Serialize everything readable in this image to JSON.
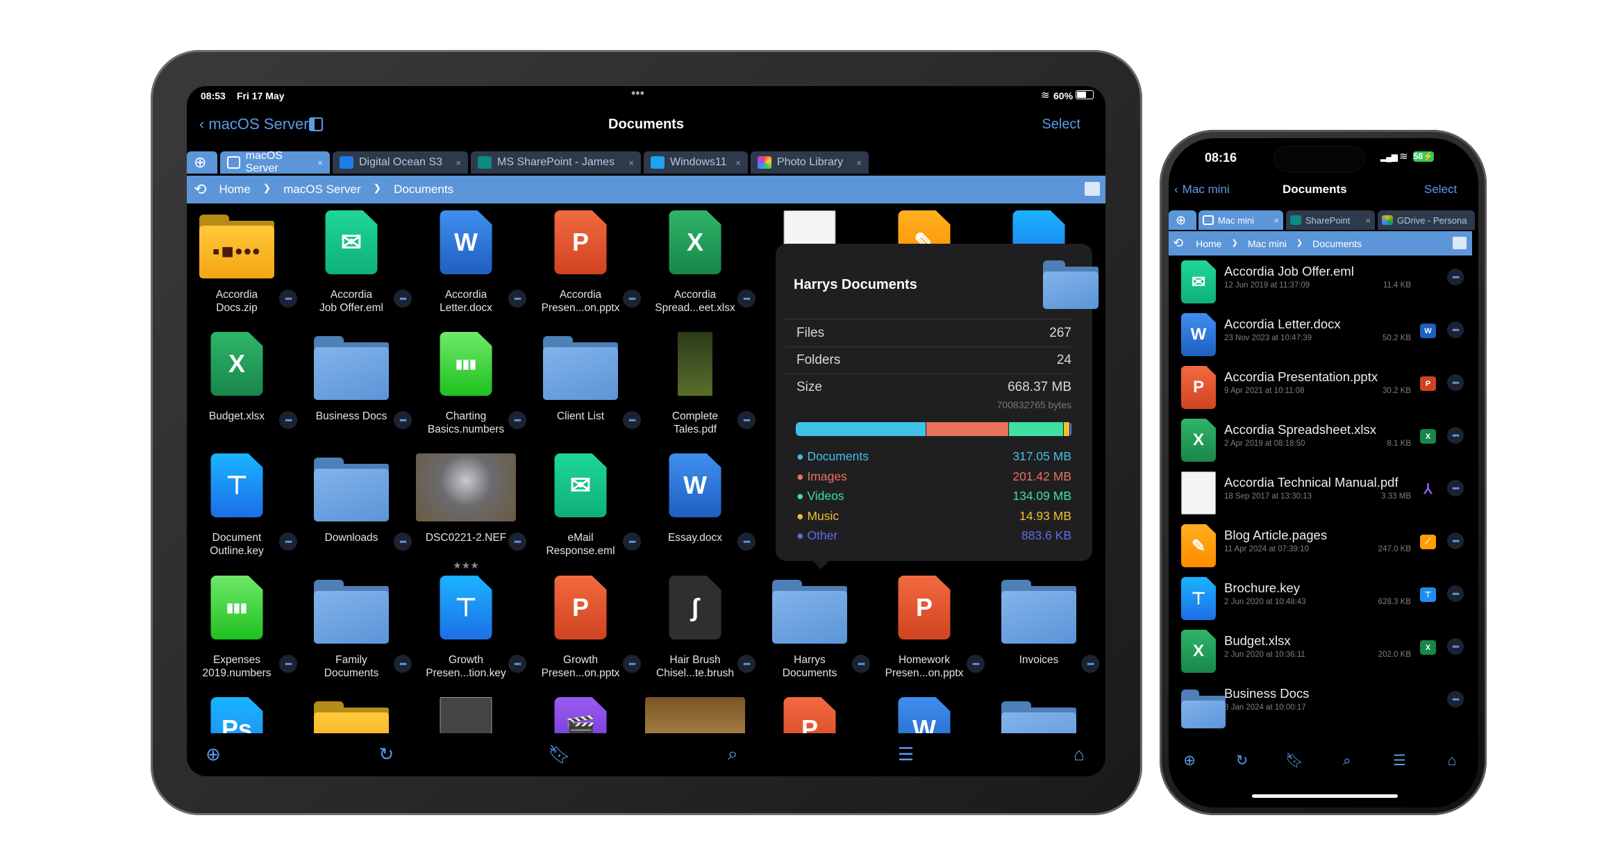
{
  "ipad": {
    "status": {
      "time": "08:53",
      "date": "Fri 17 May",
      "battery": "60%"
    },
    "nav": {
      "back_label": "macOS Server",
      "title": "Documents",
      "select_label": "Select"
    },
    "tabs": [
      {
        "label": "macOS Server",
        "icon": "monitor-icon",
        "active": true
      },
      {
        "label": "Digital Ocean S3",
        "icon": "digital-ocean-icon"
      },
      {
        "label": "MS SharePoint - James",
        "icon": "sharepoint-icon"
      },
      {
        "label": "Windows11",
        "icon": "windows-icon"
      },
      {
        "label": "Photo Library",
        "icon": "photos-icon"
      }
    ],
    "tab_close": "×",
    "breadcrumb": [
      "Home",
      "macOS Server",
      "Documents"
    ],
    "grid": [
      [
        {
          "name": "Accordia\nDocs.zip",
          "type": "zip"
        },
        {
          "name": "Accordia\nJob Offer.eml",
          "type": "eml"
        },
        {
          "name": "Accordia\nLetter.docx",
          "type": "docx"
        },
        {
          "name": "Accordia\nPresen...on.pptx",
          "type": "pptx"
        },
        {
          "name": "Accordia\nSpread...eet.xlsx",
          "type": "xlsx"
        },
        {
          "name": "",
          "type": "pdf"
        },
        {
          "name": "",
          "type": "pages"
        },
        {
          "name": "",
          "type": "keyapp"
        }
      ],
      [
        {
          "name": "Budget.xlsx",
          "type": "xlsx"
        },
        {
          "name": "Business Docs",
          "type": "folder"
        },
        {
          "name": "Charting\nBasics.numbers",
          "type": "numbers"
        },
        {
          "name": "Client List",
          "type": "folder"
        },
        {
          "name": "Complete\nTales.pdf",
          "type": "book"
        }
      ],
      [
        {
          "name": "Document\nOutline.key",
          "type": "key"
        },
        {
          "name": "Downloads",
          "type": "folder"
        },
        {
          "name": "DSC0221-2.NEF",
          "type": "photo",
          "stars": "★★★"
        },
        {
          "name": "eMail\nResponse.eml",
          "type": "eml"
        },
        {
          "name": "Essay.docx",
          "type": "docx"
        }
      ],
      [
        {
          "name": "Expenses\n2019.numbers",
          "type": "numbers"
        },
        {
          "name": "Family\nDocuments",
          "type": "folder"
        },
        {
          "name": "Growth\nPresen...tion.key",
          "type": "key"
        },
        {
          "name": "Growth\nPresen...on.pptx",
          "type": "pptx"
        },
        {
          "name": "Hair Brush\nChisel...te.brush",
          "type": "brush"
        },
        {
          "name": "Harrys\nDocuments",
          "type": "folder"
        },
        {
          "name": "Homework\nPresen...on.pptx",
          "type": "pptx"
        },
        {
          "name": "Invoices",
          "type": "folder"
        }
      ],
      [
        {
          "name": "",
          "type": "psd"
        },
        {
          "name": "",
          "type": "zip"
        },
        {
          "name": "",
          "type": "manual"
        },
        {
          "name": "",
          "type": "imovie"
        },
        {
          "name": "",
          "type": "map"
        },
        {
          "name": "",
          "type": "pptx"
        },
        {
          "name": "",
          "type": "docx"
        },
        {
          "name": "",
          "type": "folder"
        }
      ]
    ],
    "popover": {
      "title": "Harrys Documents",
      "files_label": "Files",
      "files": "267",
      "folders_label": "Folders",
      "folders": "24",
      "size_label": "Size",
      "size": "668.37 MB",
      "bytes": "700832765 bytes",
      "breakdown": [
        {
          "label": "Documents",
          "value": "317.05 MB",
          "mb": 317.05,
          "color": "#40c2e6"
        },
        {
          "label": "Images",
          "value": "201.42 MB",
          "mb": 201.42,
          "color": "#e8725a"
        },
        {
          "label": "Videos",
          "value": "134.09 MB",
          "mb": 134.09,
          "color": "#3ee0a4"
        },
        {
          "label": "Music",
          "value": "14.93 MB",
          "mb": 14.93,
          "color": "#f0c02c"
        },
        {
          "label": "Other",
          "value": "883.6 KB",
          "mb": 0.8836,
          "color": "#5b6de6"
        }
      ]
    },
    "toolbar": [
      "add-icon",
      "refresh-icon",
      "bookmark-icon",
      "search-icon",
      "sort-icon",
      "home-icon"
    ]
  },
  "iphone": {
    "status": {
      "time": "08:16",
      "battery": "58"
    },
    "nav": {
      "back_label": "Mac mini",
      "title": "Documents",
      "select_label": "Select"
    },
    "tabs": [
      {
        "label": "Mac mini",
        "icon": "monitor-icon",
        "active": true
      },
      {
        "label": "SharePoint",
        "icon": "sharepoint-icon"
      },
      {
        "label": "GDrive - Persona",
        "icon": "google-drive-icon"
      }
    ],
    "breadcrumb": [
      "Home",
      "Mac mini",
      "Documents"
    ],
    "files": [
      {
        "name": "Accordia Job Offer.eml",
        "date": "12 Jun 2019 at 11:37:09",
        "size": "11.4 KB",
        "type": "eml",
        "app": ""
      },
      {
        "name": "Accordia Letter.docx",
        "date": "23 Nov 2023 at 10:47:39",
        "size": "50.2 KB",
        "type": "docx",
        "app": "word"
      },
      {
        "name": "Accordia Presentation.pptx",
        "date": "9 Apr 2021 at 10:11:08",
        "size": "30.2 KB",
        "type": "pptx",
        "app": "powerpoint"
      },
      {
        "name": "Accordia Spreadsheet.xlsx",
        "date": "2 Apr 2019 at 08:18:50",
        "size": "8.1 KB",
        "type": "xlsx",
        "app": "excel"
      },
      {
        "name": "Accordia Technical Manual.pdf",
        "date": "18 Sep 2017 at 13:30:13",
        "size": "3.33 MB",
        "type": "pdf",
        "app": "acrobat"
      },
      {
        "name": "Blog Article.pages",
        "date": "11 Apr 2024 at 07:39:10",
        "size": "247.0 KB",
        "type": "pages",
        "app": "pages"
      },
      {
        "name": "Brochure.key",
        "date": "2 Jun 2020 at 10:48:43",
        "size": "628.3 KB",
        "type": "key",
        "app": "keynote"
      },
      {
        "name": "Budget.xlsx",
        "date": "2 Jun 2020 at 10:36:11",
        "size": "202.0 KB",
        "type": "xlsx",
        "app": "excel"
      },
      {
        "name": "Business Docs",
        "date": "3 Jan 2024 at 10:00:17",
        "size": "",
        "type": "folder",
        "app": ""
      }
    ],
    "toolbar": [
      "add-icon",
      "refresh-icon",
      "bookmark-icon",
      "search-icon",
      "sort-icon",
      "home-icon"
    ]
  }
}
